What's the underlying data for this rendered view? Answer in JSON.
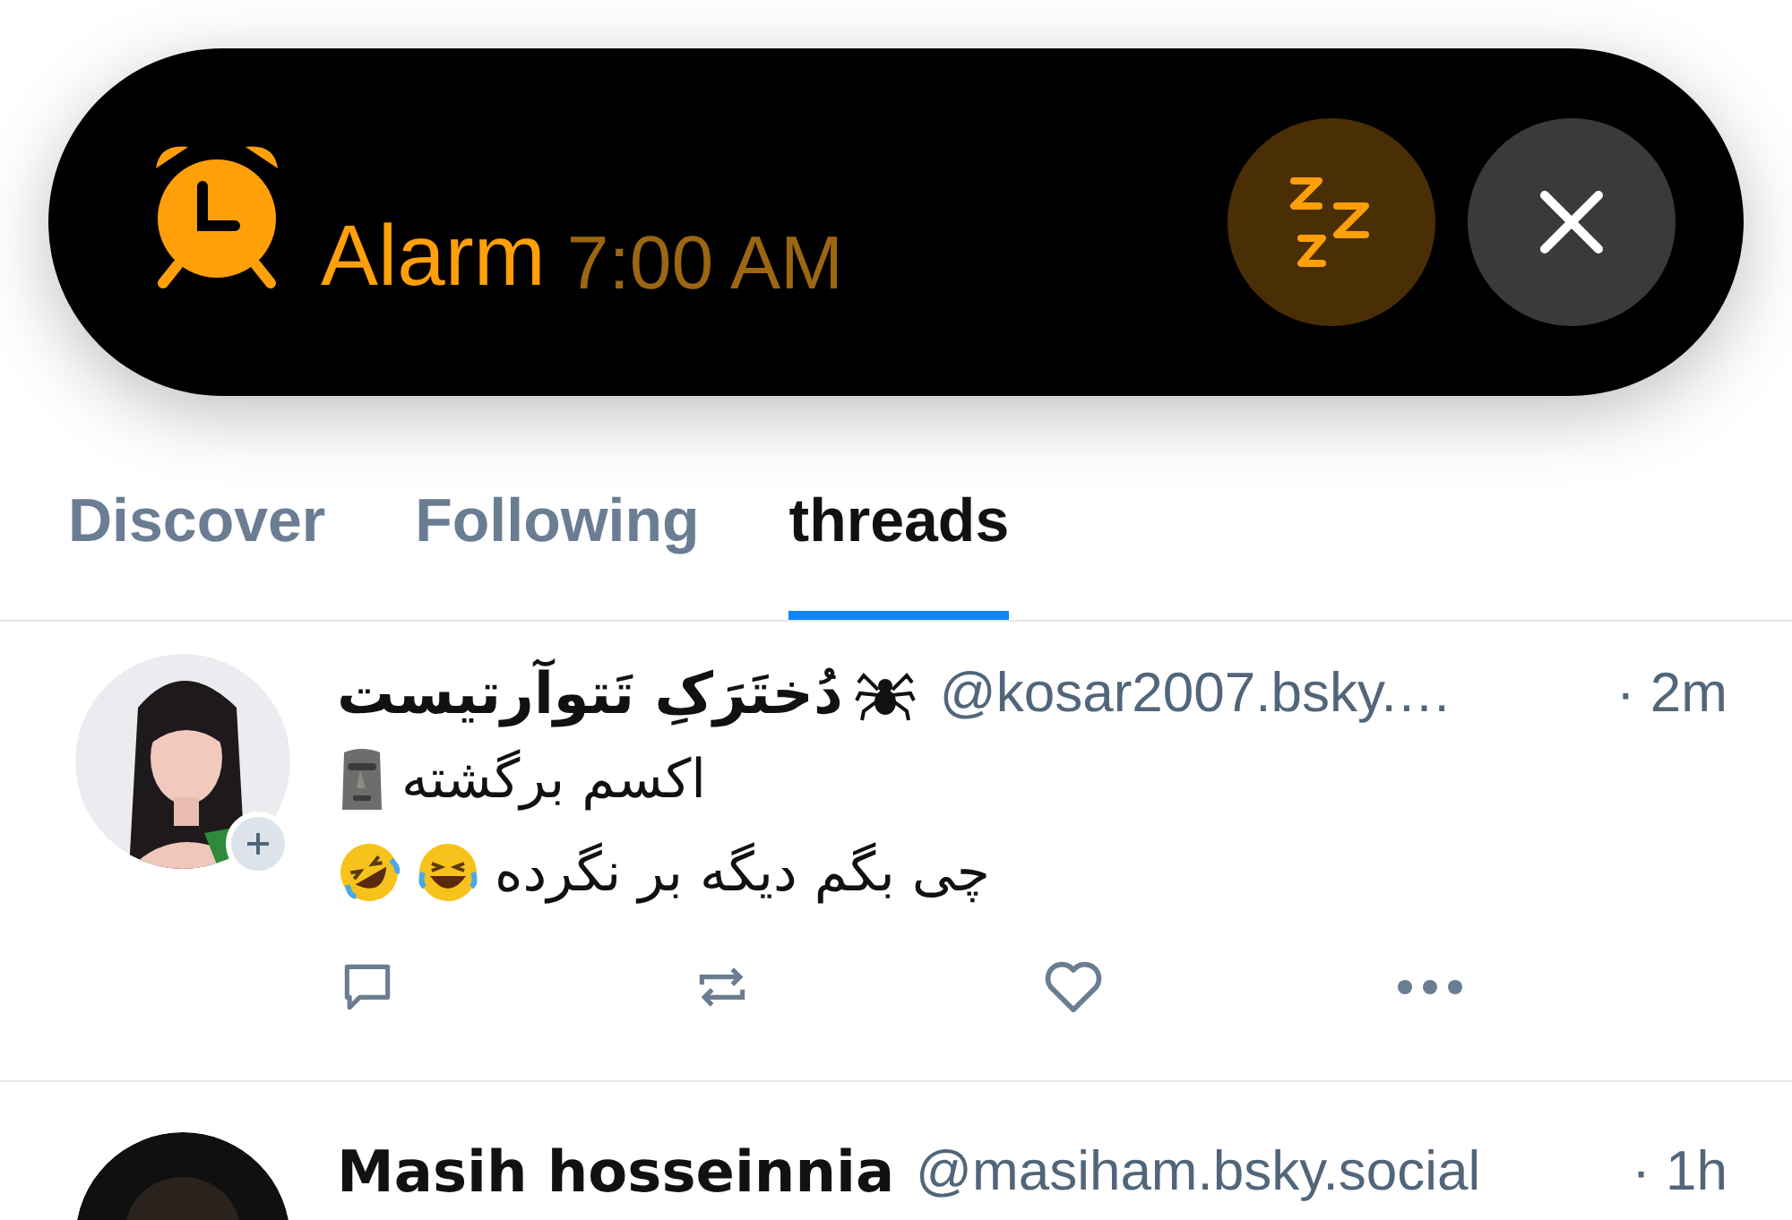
{
  "alarm": {
    "label": "Alarm",
    "time": "7:00 AM"
  },
  "tabs": [
    {
      "label": "Discover",
      "selected": false
    },
    {
      "label": "Following",
      "selected": false
    },
    {
      "label": "threads",
      "selected": true
    }
  ],
  "posts": [
    {
      "name": "دُختَرَکِ تَتوآرتیست",
      "name_emoji": {
        "kind": "spider"
      },
      "handle": "@kosar2007.bsky.…",
      "time": "· 2m",
      "follow_badge": true,
      "lines": [
        {
          "text": "اکسم برگشته",
          "emoji": [
            {
              "kind": "moai"
            }
          ]
        },
        {
          "text": "چی بگم دیگه بر نگرده",
          "emoji": [
            {
              "kind": "rofl"
            },
            {
              "kind": "joy"
            }
          ]
        }
      ],
      "actions": true
    },
    {
      "name": "Masih hosseinnia",
      "handle": "@masiham.bsky.social",
      "time": "· 1h",
      "follow_badge": false,
      "actions": false
    }
  ]
}
